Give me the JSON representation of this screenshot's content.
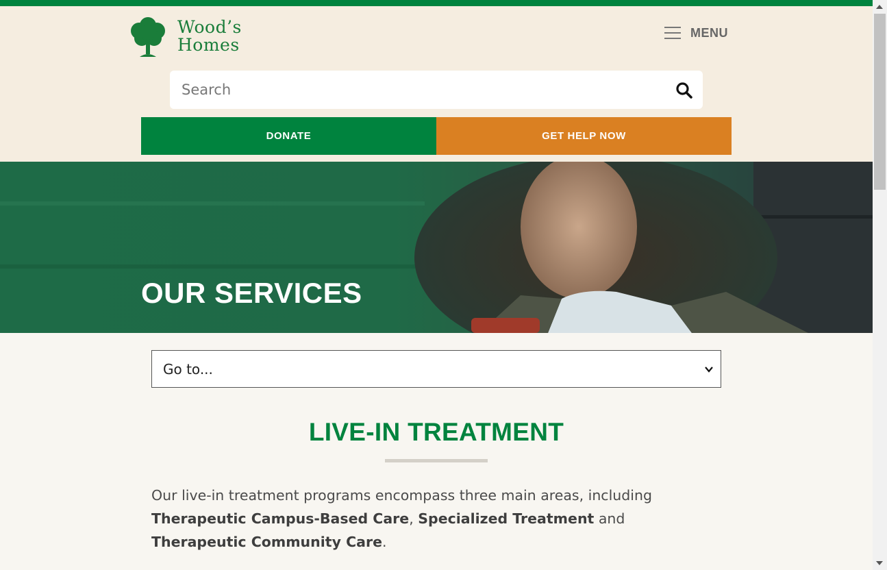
{
  "brand": {
    "line1": "Wood’s",
    "line2": "Homes",
    "color": "#00833e"
  },
  "header": {
    "menu_label": "MENU",
    "search_placeholder": "Search",
    "donate_label": "DONATE",
    "help_label": "GET HELP NOW",
    "donate_color": "#00833e",
    "help_color": "#da8022"
  },
  "hero": {
    "title": "OUR SERVICES"
  },
  "nav": {
    "goto_value": "Go to..."
  },
  "section": {
    "title": "LIVE-IN TREATMENT",
    "intro_part1": "Our live-in treatment programs encompass three main areas, including ",
    "bold1": "Therapeutic Campus-Based Care",
    "sep1": ", ",
    "bold2": "Specialized Treatment",
    "sep2": " and ",
    "bold3": "Therapeutic Community Care",
    "end": "."
  },
  "icons": {
    "logo": "tree-icon",
    "menu": "hamburger-icon",
    "search": "search-icon",
    "dropdown": "chevron-down-icon"
  }
}
